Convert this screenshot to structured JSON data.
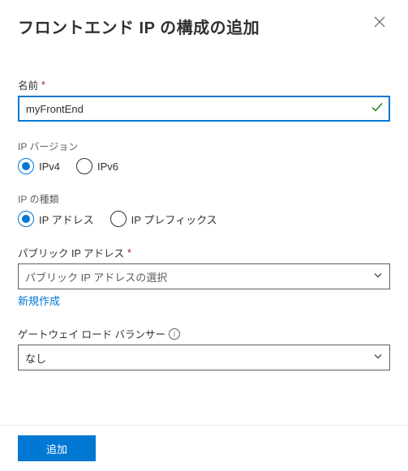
{
  "header": {
    "title": "フロントエンド IP の構成の追加"
  },
  "name": {
    "label": "名前",
    "value": "myFrontEnd"
  },
  "ipVersion": {
    "label": "IP バージョン",
    "options": {
      "ipv4": "IPv4",
      "ipv6": "IPv6"
    },
    "selected": "ipv4"
  },
  "ipType": {
    "label": "IP の種類",
    "options": {
      "address": "IP アドレス",
      "prefix": "IP プレフィックス"
    },
    "selected": "address"
  },
  "publicIp": {
    "label": "パブリック IP アドレス",
    "placeholder": "パブリック IP アドレスの選択",
    "createLink": "新規作成"
  },
  "gatewayLb": {
    "label": "ゲートウェイ ロード バランサー",
    "value": "なし"
  },
  "footer": {
    "add": "追加"
  }
}
